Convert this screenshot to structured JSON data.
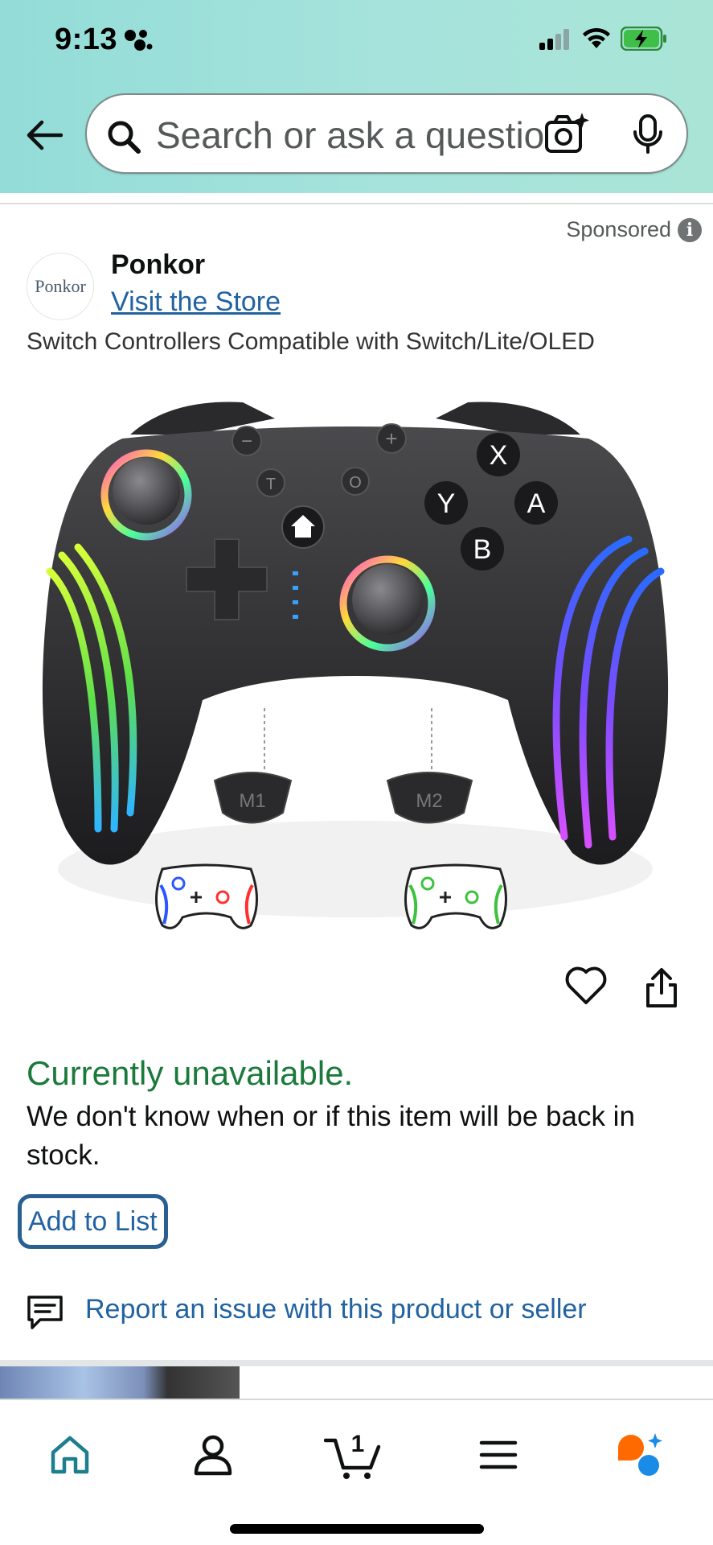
{
  "status_bar": {
    "time": "9:13"
  },
  "search": {
    "placeholder": "Search or ask a question"
  },
  "ad": {
    "sponsored_label": "Sponsored",
    "info_symbol": "i",
    "brand_logo_text": "Ponkor",
    "brand_name": "Ponkor",
    "store_link": "Visit the Store",
    "product_title": "Switch Controllers Compatible with Switch/Lite/OLED"
  },
  "product_image": {
    "face_buttons": [
      "X",
      "Y",
      "A",
      "B"
    ],
    "button_minus": "−",
    "button_plus": "+",
    "button_turbo": "T",
    "button_capture": "O",
    "paddles": [
      "M1",
      "M2"
    ]
  },
  "availability": {
    "status": "Currently unavailable.",
    "note": "We don't know when or if this item will be back in stock."
  },
  "actions": {
    "add_to_list": "Add to List",
    "report": "Report an issue with this product or seller"
  },
  "bottom_nav": {
    "cart_count": "1",
    "items": [
      "home",
      "account",
      "cart",
      "menu",
      "rufus"
    ]
  },
  "colors": {
    "header_gradient_start": "#93dcd8",
    "availability_green": "#1b7a3b",
    "link_blue": "#2162a1",
    "nav_teal": "#1d7e8c",
    "rufus_orange": "#ff6a00",
    "rufus_blue": "#1a8ce8"
  }
}
